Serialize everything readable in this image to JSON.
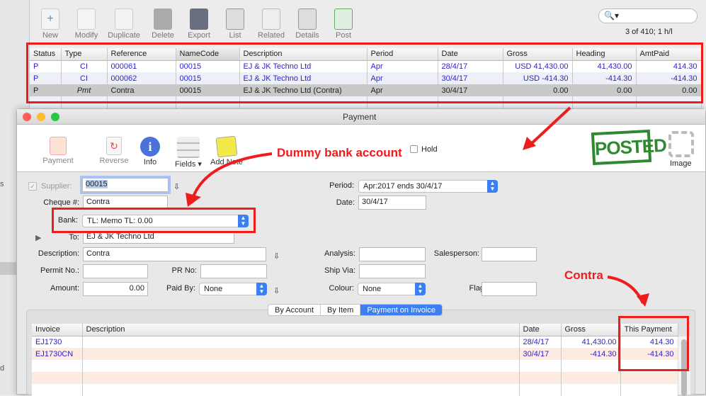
{
  "toolbar": {
    "items": [
      "New",
      "Modify",
      "Duplicate",
      "Delete",
      "Export",
      "List",
      "Related",
      "Details",
      "Post"
    ]
  },
  "search": {
    "placeholder": ""
  },
  "record_count": "3 of 410; 1 h/l",
  "sidebar": {
    "fragments": [
      "s",
      "d"
    ]
  },
  "list": {
    "columns": [
      "Status",
      "Type",
      "Reference",
      "NameCode",
      "Description",
      "Period",
      "Date",
      "Gross",
      "Heading",
      "AmtPaid"
    ],
    "rows": [
      [
        "P",
        "CI",
        "000061",
        "00015",
        "EJ & JK Techno Ltd",
        "Apr",
        "28/4/17",
        "USD 41,430.00",
        "41,430.00",
        "414.30"
      ],
      [
        "P",
        "CI",
        "000062",
        "00015",
        "EJ & JK Techno Ltd",
        "Apr",
        "30/4/17",
        "USD -414.30",
        "-414.30",
        "-414.30"
      ],
      [
        "P",
        "Pmt",
        "Contra",
        "00015",
        "EJ & JK Techno Ltd (Contra)",
        "Apr",
        "30/4/17",
        "0.00",
        "0.00",
        "0.00"
      ]
    ]
  },
  "window": {
    "title": "Payment",
    "toolbar": [
      "Payment",
      "Reverse",
      "Info",
      "Fields",
      "Add Note"
    ],
    "stamp": "POSTED",
    "image_label": "Image",
    "hold_label": "Hold",
    "form": {
      "supplier_label": "Supplier:",
      "supplier": "00015",
      "cheque_label": "Cheque #:",
      "cheque": "Contra",
      "bank_label": "Bank:",
      "bank": "TL: Memo TL: 0.00",
      "to_label": "To:",
      "to": "EJ & JK Techno Ltd",
      "description_label": "Description:",
      "description": "Contra",
      "permit_label": "Permit No.:",
      "permit": "",
      "prno_label": "PR No:",
      "prno": "",
      "amount_label": "Amount:",
      "amount": "0.00",
      "paidby_label": "Paid By:",
      "paidby": "None",
      "period_label": "Period:",
      "period": "Apr:2017 ends 30/4/17",
      "date_label": "Date:",
      "date": "30/4/17",
      "analysis_label": "Analysis:",
      "salesperson_label": "Salesperson:",
      "shipvia_label": "Ship Via:",
      "colour_label": "Colour:",
      "colour": "None",
      "flag_label": "Flag:"
    },
    "tabs": [
      "By Account",
      "By Item",
      "Payment on Invoice"
    ],
    "invoice_table": {
      "columns": [
        "Invoice",
        "Description",
        "Date",
        "Gross",
        "This Payment"
      ],
      "rows": [
        [
          "EJ1730",
          "",
          "28/4/17",
          "41,430.00",
          "414.30"
        ],
        [
          "EJ1730CN",
          "",
          "30/4/17",
          "-414.30",
          "-414.30"
        ]
      ]
    }
  },
  "annotations": {
    "dummy_bank": "Dummy bank account",
    "contra": "Contra"
  },
  "colors": {
    "accent": "#3b7ff1",
    "annotation": "#ee1c1c",
    "link": "#2a1fc7"
  }
}
